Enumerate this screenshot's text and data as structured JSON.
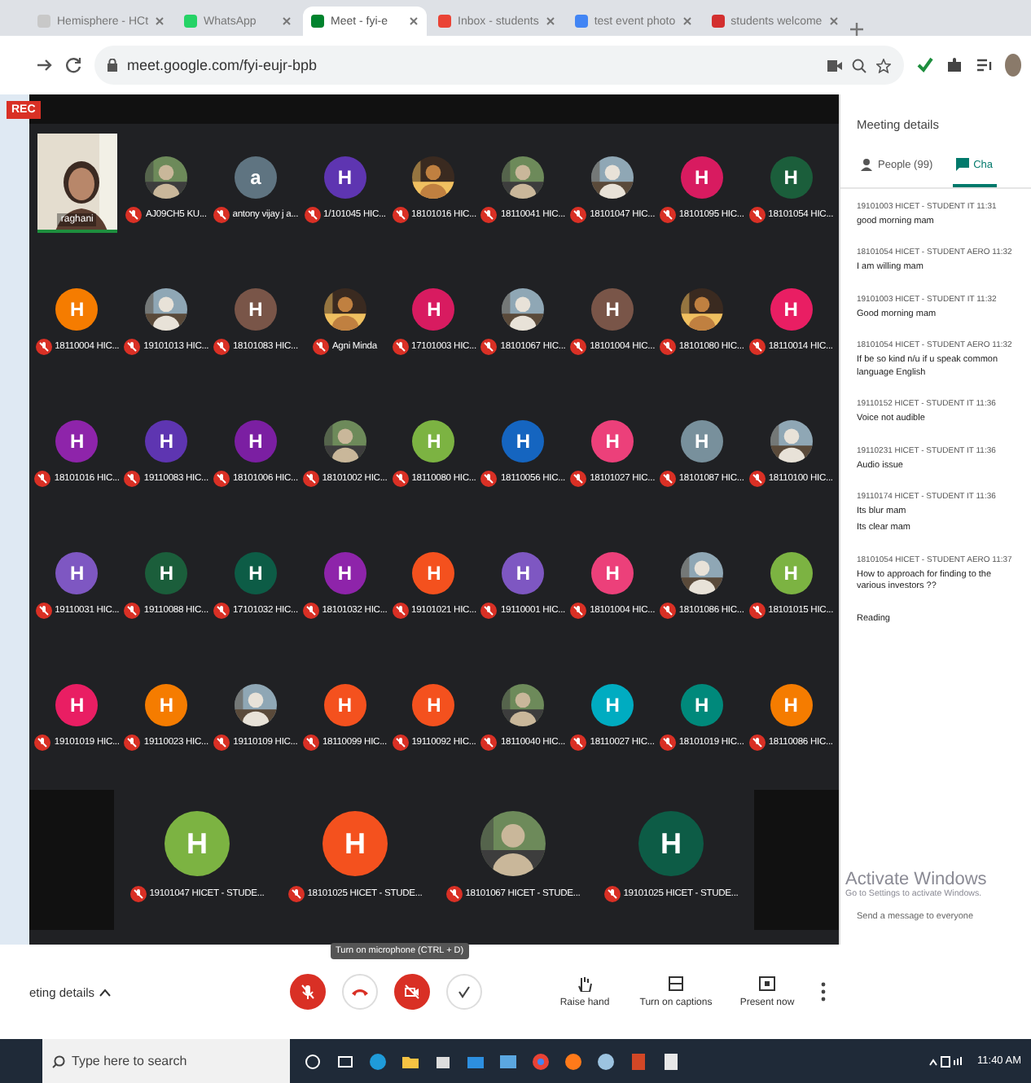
{
  "browser": {
    "tabs": [
      {
        "label": "Hemisphere - HCt",
        "selected": false,
        "kind": "page"
      },
      {
        "label": "WhatsApp",
        "selected": false,
        "kind": "chat"
      },
      {
        "label": "Meet - fyi-e",
        "selected": true,
        "kind": "meet"
      },
      {
        "label": "Inbox - students",
        "selected": false,
        "kind": "mail"
      },
      {
        "label": "test event photo",
        "selected": false,
        "kind": "drive"
      },
      {
        "label": "students welcome",
        "selected": false,
        "kind": "video"
      }
    ],
    "url": "meet.google.com/fyi-eujr-bpb"
  },
  "meeting": {
    "recording_badge": "REC",
    "self_view": {
      "name": "raghani"
    },
    "participants": [
      {
        "name": "AJ09CH5 KU...",
        "kind": "picture"
      },
      {
        "name": "antony vijay j a...",
        "kind": "letter",
        "letter": "a",
        "color": "#5f7481"
      },
      {
        "name": "1/101045 HIC...",
        "kind": "letter",
        "letter": "H",
        "color": "#5e35b1"
      },
      {
        "name": "18101016 HIC...",
        "kind": "picture"
      },
      {
        "name": "18110041 HIC...",
        "kind": "picture"
      },
      {
        "name": "18101047 HIC...",
        "kind": "picture"
      },
      {
        "name": "18101095 HIC...",
        "kind": "letter",
        "letter": "H",
        "color": "#d81b60"
      },
      {
        "name": "18101054 HIC...",
        "kind": "letter",
        "letter": "H",
        "color": "#1b5e3b"
      },
      {
        "name": "18110004 HIC...",
        "kind": "letter",
        "letter": "H",
        "color": "#f57c00"
      },
      {
        "name": "19101013 HIC...",
        "kind": "picture"
      },
      {
        "name": "18101083 HIC...",
        "kind": "letter",
        "letter": "H",
        "color": "#795548"
      },
      {
        "name": "Agni Minda",
        "kind": "picture"
      },
      {
        "name": "17101003 HIC...",
        "kind": "letter",
        "letter": "H",
        "color": "#d81b60"
      },
      {
        "name": "18101067 HIC...",
        "kind": "picture"
      },
      {
        "name": "18101004 HIC...",
        "kind": "letter",
        "letter": "H",
        "color": "#795548"
      },
      {
        "name": "18101080 HIC...",
        "kind": "picture"
      },
      {
        "name": "18110014 HIC...",
        "kind": "letter",
        "letter": "H",
        "color": "#e91e63"
      },
      {
        "name": "18101016 HIC...",
        "kind": "letter",
        "letter": "H",
        "color": "#8e24aa"
      },
      {
        "name": "19110083 HIC...",
        "kind": "letter",
        "letter": "H",
        "color": "#5e35b1"
      },
      {
        "name": "18101006 HIC...",
        "kind": "letter",
        "letter": "H",
        "color": "#7b1fa2"
      },
      {
        "name": "18101002 HIC...",
        "kind": "picture"
      },
      {
        "name": "18110080 HIC...",
        "kind": "letter",
        "letter": "H",
        "color": "#7cb342"
      },
      {
        "name": "18110056 HIC...",
        "kind": "letter",
        "letter": "H",
        "color": "#1565c0"
      },
      {
        "name": "18101027 HIC...",
        "kind": "letter",
        "letter": "H",
        "color": "#ec407a"
      },
      {
        "name": "18101087 HIC...",
        "kind": "letter",
        "letter": "H",
        "color": "#78909c"
      },
      {
        "name": "18110100 HIC...",
        "kind": "picture"
      },
      {
        "name": "19110031 HIC...",
        "kind": "letter",
        "letter": "H",
        "color": "#7e57c2"
      },
      {
        "name": "19110088 HIC...",
        "kind": "letter",
        "letter": "H",
        "color": "#1b5e3b"
      },
      {
        "name": "17101032 HIC...",
        "kind": "letter",
        "letter": "H",
        "color": "#0d5c46"
      },
      {
        "name": "18101032 HIC...",
        "kind": "letter",
        "letter": "H",
        "color": "#8e24aa"
      },
      {
        "name": "19101021 HIC...",
        "kind": "letter",
        "letter": "H",
        "color": "#f4511e"
      },
      {
        "name": "19110001 HIC...",
        "kind": "letter",
        "letter": "H",
        "color": "#7e57c2"
      },
      {
        "name": "18101004 HIC...",
        "kind": "letter",
        "letter": "H",
        "color": "#ec407a"
      },
      {
        "name": "18101086 HIC...",
        "kind": "picture"
      },
      {
        "name": "18101015 HIC...",
        "kind": "letter",
        "letter": "H",
        "color": "#7cb342"
      },
      {
        "name": "19101019 HIC...",
        "kind": "letter",
        "letter": "H",
        "color": "#e91e63"
      },
      {
        "name": "19110023 HIC...",
        "kind": "letter",
        "letter": "H",
        "color": "#f57c00"
      },
      {
        "name": "19110109 HIC...",
        "kind": "picture"
      },
      {
        "name": "18110099 HIC...",
        "kind": "letter",
        "letter": "H",
        "color": "#f4511e"
      },
      {
        "name": "19110092 HIC...",
        "kind": "letter",
        "letter": "H",
        "color": "#f4511e"
      },
      {
        "name": "18110040 HIC...",
        "kind": "picture"
      },
      {
        "name": "18110027 HIC...",
        "kind": "letter",
        "letter": "H",
        "color": "#00acc1"
      },
      {
        "name": "18101019 HIC...",
        "kind": "letter",
        "letter": "H",
        "color": "#00897b"
      },
      {
        "name": "18110086 HIC...",
        "kind": "letter",
        "letter": "H",
        "color": "#f57c00"
      }
    ],
    "featured": [
      {
        "name": "19101047 HICET - STUDE...",
        "kind": "letter",
        "letter": "H",
        "color": "#7cb342"
      },
      {
        "name": "18101025 HICET - STUDE...",
        "kind": "letter",
        "letter": "H",
        "color": "#f4511e"
      },
      {
        "name": "18101067 HICET - STUDE...",
        "kind": "picture"
      },
      {
        "name": "19101025 HICET - STUDE...",
        "kind": "letter",
        "letter": "H",
        "color": "#0d5c46"
      }
    ],
    "tooltip": "Turn on microphone (CTRL + D)"
  },
  "side_panel": {
    "title": "Meeting details",
    "tabs": [
      {
        "label": "People (99)",
        "selected": false,
        "kind": "people"
      },
      {
        "label": "Cha",
        "selected": true,
        "kind": "chat"
      }
    ],
    "messages": [
      {
        "sender": "19101003 HICET - STUDENT IT",
        "time": "11:31",
        "lines": [
          "good morning mam"
        ]
      },
      {
        "sender": "18101054 HICET - STUDENT AERO",
        "time": "11:32",
        "lines": [
          "I am willing mam"
        ]
      },
      {
        "sender": "19101003 HICET - STUDENT IT",
        "time": "11:32",
        "lines": [
          "Good morning mam"
        ]
      },
      {
        "sender": "18101054 HICET - STUDENT AERO",
        "time": "11:32",
        "lines": [
          "If be so kind n/u if u speak common language English"
        ]
      },
      {
        "sender": "19110152 HICET - STUDENT IT",
        "time": "11:36",
        "lines": [
          "Voice not audible"
        ]
      },
      {
        "sender": "19110231 HICET - STUDENT IT",
        "time": "11:36",
        "lines": [
          "Audio issue"
        ]
      },
      {
        "sender": "19110174 HICET - STUDENT IT",
        "time": "11:36",
        "lines": [
          "Its blur mam",
          "Its clear mam"
        ]
      },
      {
        "sender": "18101054 HICET - STUDENT AERO",
        "time": "11:37",
        "lines": [
          "How to approach for finding to the various investors ??"
        ]
      },
      {
        "lines": [
          "Reading"
        ]
      }
    ],
    "message_input": {
      "placeholder": "Send a message to everyone"
    },
    "activation_notice": {
      "title": "Activate Windows",
      "text": "Go to Settings to activate Windows."
    }
  },
  "controls": {
    "details": "eting details",
    "mic": {
      "on": false
    },
    "camera": {
      "on": false
    },
    "actions": [
      {
        "label": "Raise hand",
        "kind": "hand"
      },
      {
        "label": "Turn on captions",
        "kind": "captions"
      },
      {
        "label": "Present now",
        "kind": "present"
      }
    ]
  },
  "taskbar": {
    "search_placeholder": "Type here to search",
    "time": "11:40 AM"
  }
}
